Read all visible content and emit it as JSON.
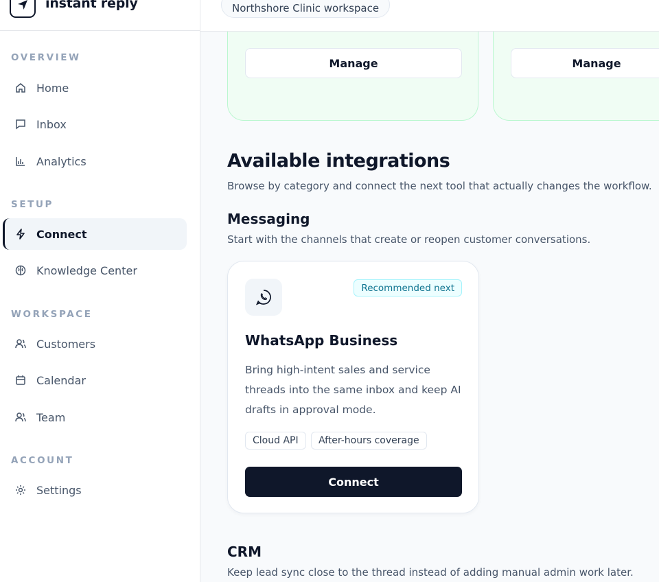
{
  "brand": {
    "name": "instant reply"
  },
  "sidebar": {
    "sections": [
      {
        "label": "OVERVIEW",
        "items": [
          {
            "label": "Home",
            "icon": "home-icon"
          },
          {
            "label": "Inbox",
            "icon": "inbox-icon"
          },
          {
            "label": "Analytics",
            "icon": "analytics-icon"
          }
        ]
      },
      {
        "label": "SETUP",
        "items": [
          {
            "label": "Connect",
            "icon": "bolt-icon",
            "active": true
          },
          {
            "label": "Knowledge Center",
            "icon": "brain-icon"
          }
        ]
      },
      {
        "label": "WORKSPACE",
        "items": [
          {
            "label": "Customers",
            "icon": "users-icon"
          },
          {
            "label": "Calendar",
            "icon": "calendar-icon"
          },
          {
            "label": "Team",
            "icon": "team-icon"
          }
        ]
      },
      {
        "label": "ACCOUNT",
        "items": [
          {
            "label": "Settings",
            "icon": "gear-icon"
          }
        ]
      }
    ]
  },
  "topbar": {
    "workspace": "Northshore Clinic workspace"
  },
  "connected": {
    "manage_label": "Manage"
  },
  "available": {
    "title": "Available integrations",
    "subtitle": "Browse by category and connect the next tool that actually changes the workflow."
  },
  "categories": [
    {
      "title": "Messaging",
      "subtitle": "Start with the channels that create or reopen customer conversations."
    },
    {
      "title": "CRM",
      "subtitle": "Keep lead sync close to the thread instead of adding manual admin work later."
    }
  ],
  "integration": {
    "name": "WhatsApp Business",
    "icon": "whatsapp-icon",
    "badge": "Recommended next",
    "description": "Bring high-intent sales and service threads into the same inbox and keep AI drafts in approval mode.",
    "tags": [
      "Cloud API",
      "After-hours coverage"
    ],
    "cta": "Connect"
  },
  "colors": {
    "primary": "#0f172a",
    "badge": "#0e7490",
    "connected_bg": "#f0fdf4"
  }
}
